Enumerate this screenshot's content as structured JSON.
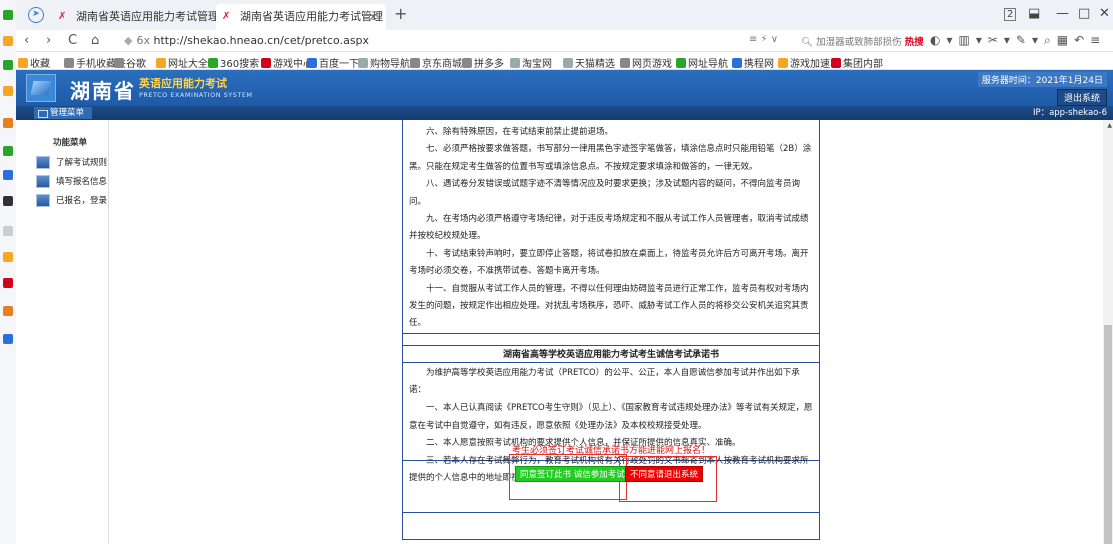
{
  "browser": {
    "tabs": [
      {
        "title": "湖南省英语应用能力考试管理系统",
        "active": false
      },
      {
        "title": "湖南省英语应用能力考试管理系统",
        "active": true
      }
    ],
    "new_tab_symbol": "+",
    "window_controls": {
      "count": "2",
      "minimize": "—",
      "maximize": "□",
      "close": "✕"
    },
    "nav": {
      "back": "‹",
      "forward": "›",
      "reload": "C",
      "home": "⌂"
    },
    "url": "http://shekao.hneao.cn/cet/pretco.aspx",
    "url_prefix": "6x",
    "search_placeholder": "加湿器或致肺部损伤",
    "search_hot": "热搜",
    "bookmarks": [
      {
        "label": "收藏",
        "color": "#f5a623"
      },
      {
        "label": "手机收藏夹",
        "color": "#888888"
      },
      {
        "label": "谷歌",
        "color": "#888888"
      },
      {
        "label": "网址大全",
        "color": "#f5a623"
      },
      {
        "label": "360搜索",
        "color": "#2aa52a"
      },
      {
        "label": "游戏中心",
        "color": "#d0021b"
      },
      {
        "label": "百度一下",
        "color": "#2b6fdc"
      },
      {
        "label": "购物导航",
        "color": "#9aa"
      },
      {
        "label": "京东商城",
        "color": "#888888"
      },
      {
        "label": "拼多多",
        "color": "#888888"
      },
      {
        "label": "淘宝网",
        "color": "#9aa"
      },
      {
        "label": "天猫精选",
        "color": "#9aa"
      },
      {
        "label": "网页游戏",
        "color": "#888888"
      },
      {
        "label": "网址导航",
        "color": "#2aa52a"
      },
      {
        "label": "携程网",
        "color": "#2b6fdc"
      },
      {
        "label": "游戏加速",
        "color": "#f5a623"
      },
      {
        "label": "集团内部",
        "color": "#d0021b"
      }
    ]
  },
  "header": {
    "title": "湖南省",
    "subtitle": "英语应用能力考试",
    "subtitle_en": "PRETCO EXAMINATION SYSTEM",
    "server_time": "服务器时间：2021年1月24日",
    "logout": "退出系统",
    "menu_label": "管理菜单",
    "ip": "IP：app-shekao-6"
  },
  "sidebar": {
    "title": "功能菜单",
    "items": [
      {
        "label": "了解考试规则"
      },
      {
        "label": "填写报名信息"
      },
      {
        "label": "已报名，登录"
      }
    ]
  },
  "rules": [
    "六、除有特殊原因，在考试结束前禁止提前退场。",
    "七、必须严格按要求做答题，书写部分一律用黑色字迹签字笔做答，填涂信息点时只能用铅笔（2B）涂黑。只能在规定考生做答的位置书写或填涂信息点。不按规定要求填涂和做答的，一律无效。",
    "八、遇试卷分发错误或试题字迹不清等情况应及时要求更换；涉及试题内容的疑问，不得向监考员询问。",
    "九、在考场内必须严格遵守考场纪律，对于违反考场规定和不服从考试工作人员管理者，取消考试成绩并按校纪校规处理。",
    "十、考试结束铃声响时，要立即停止答题，将试卷扣放在桌面上，待监考员允许后方可离开考场。离开考场时必须交卷，不准携带试卷、答题卡离开考场。",
    "十一、自觉服从考试工作人员的管理，不得以任何理由妨碍监考员进行正常工作，监考员有权对考场内发生的问题，按规定作出相应处理。对扰乱考场秩序，恐吓、威胁考试工作人员的将移交公安机关追究其责任。"
  ],
  "pledge": {
    "title": "湖南省高等学校英语应用能力考试考生诚信考试承诺书",
    "paragraphs": [
      "为维护高等学校英语应用能力考试（PRETCO）的公平、公正，本人自愿诚信参加考试并作出如下承诺：",
      "一、本人已认真阅读《PRETCO考生守则》（见上）、《国家教育考试违规处理办法》等考试有关规定，愿意在考试中自觉遵守，如有违反，愿意依照《处理办法》及本校校规接受处理。",
      "二、本人愿意按照考试机构的要求提供个人信息，并保证所提供的信息真实、准确。",
      "三、若本人存在考试舞弊行为，教育考试机构将有关行政处罚的文书邮寄到本人按教育考试机构要求所提供的个人信息中的地址即视为有效送达。"
    ],
    "notice": "考生必须签订考试诚信承诺书方能进能网上报名！",
    "agree_button": "同意签订此书 诚信参加考试",
    "disagree_button": "不同意请退出系统"
  }
}
